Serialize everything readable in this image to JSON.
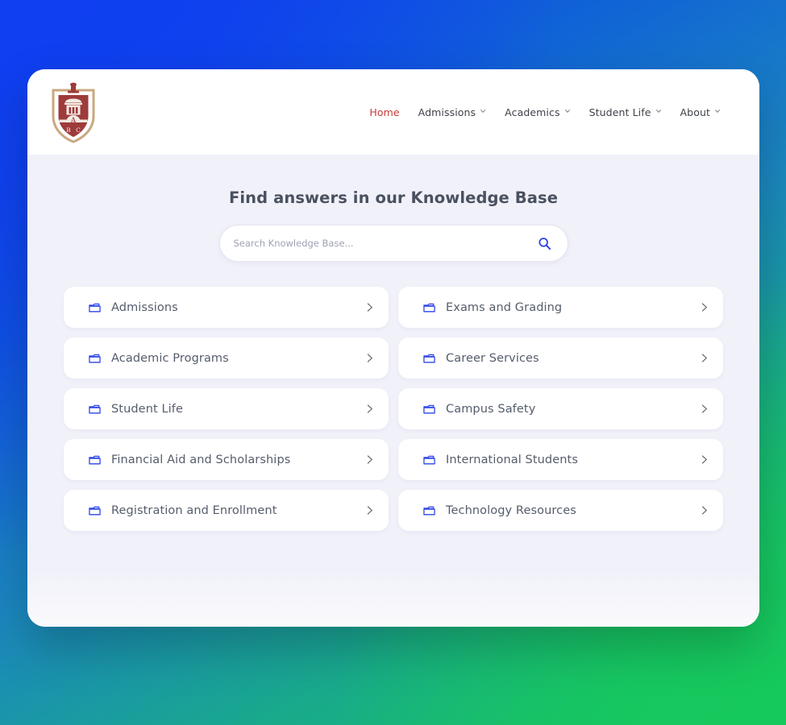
{
  "window": {
    "brand_logo": "university-shield-logo",
    "logo_letters": [
      "A",
      "B",
      "C"
    ]
  },
  "nav": {
    "items": [
      {
        "label": "Home",
        "icon": null,
        "active": true
      },
      {
        "label": "Admissions",
        "icon": "chevron-down-icon",
        "active": false
      },
      {
        "label": "Academics",
        "icon": "chevron-down-icon",
        "active": false
      },
      {
        "label": "Student Life",
        "icon": "chevron-down-icon",
        "active": false
      },
      {
        "label": "About",
        "icon": "chevron-down-icon",
        "active": false
      }
    ]
  },
  "hero": {
    "title": "Find answers in our Knowledge Base"
  },
  "search": {
    "placeholder": "Search Knowledge Base...",
    "value": "",
    "icon": "search-icon"
  },
  "categories": [
    {
      "label": "Admissions",
      "icon": "folder-icon",
      "arrow": "chevron-right-icon"
    },
    {
      "label": "Exams and Grading",
      "icon": "folder-icon",
      "arrow": "chevron-right-icon"
    },
    {
      "label": "Academic Programs",
      "icon": "folder-icon",
      "arrow": "chevron-right-icon"
    },
    {
      "label": "Career Services",
      "icon": "folder-icon",
      "arrow": "chevron-right-icon"
    },
    {
      "label": "Student Life",
      "icon": "folder-icon",
      "arrow": "chevron-right-icon"
    },
    {
      "label": "Campus Safety",
      "icon": "folder-icon",
      "arrow": "chevron-right-icon"
    },
    {
      "label": "Financial Aid and Scholarships",
      "icon": "folder-icon",
      "arrow": "chevron-right-icon"
    },
    {
      "label": "International Students",
      "icon": "folder-icon",
      "arrow": "chevron-right-icon"
    },
    {
      "label": "Registration and Enrollment",
      "icon": "folder-icon",
      "arrow": "chevron-right-icon"
    },
    {
      "label": "Technology Resources",
      "icon": "folder-icon",
      "arrow": "chevron-right-icon"
    }
  ],
  "colors": {
    "accent_blue": "#2b44e8",
    "nav_active_red": "#c23b37",
    "logo_crimson": "#9e3b3b",
    "logo_gold": "#c9a97e",
    "text_slate": "#555d6b",
    "page_bg": "#f1f1fa",
    "backdrop_blue": "#0f3ff0",
    "backdrop_green": "#16c95c"
  }
}
